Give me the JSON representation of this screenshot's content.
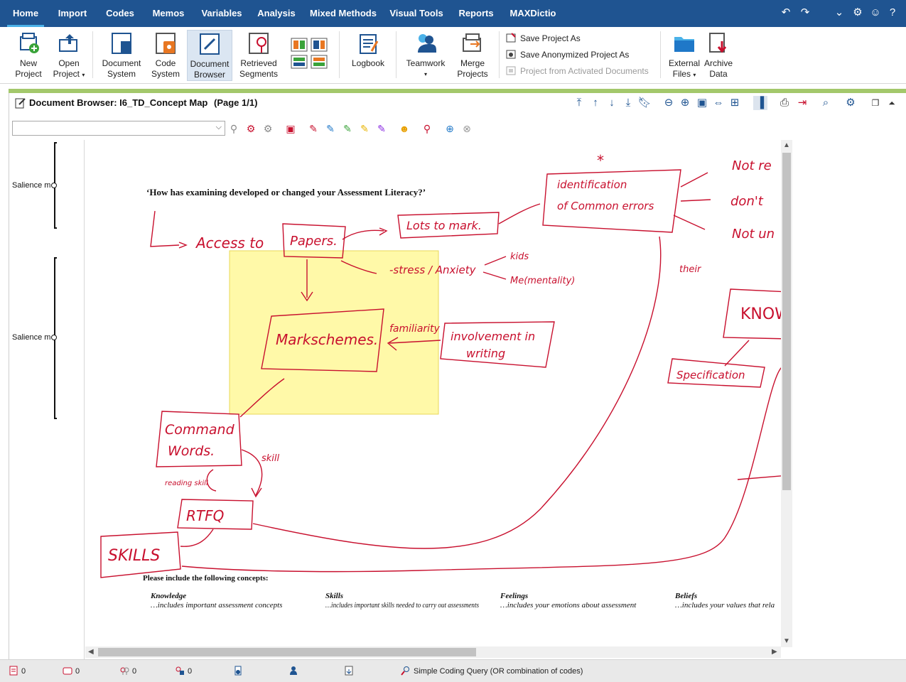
{
  "menu": {
    "tabs": [
      "Home",
      "Import",
      "Codes",
      "Memos",
      "Variables",
      "Analysis",
      "Mixed Methods",
      "Visual Tools",
      "Reports",
      "MAXDictio"
    ],
    "active": "Home"
  },
  "ribbon": {
    "new_project": [
      "New",
      "Project"
    ],
    "open_project": [
      "Open",
      "Project"
    ],
    "document_system": [
      "Document",
      "System"
    ],
    "code_system": [
      "Code",
      "System"
    ],
    "document_browser": [
      "Document",
      "Browser"
    ],
    "retrieved_segments": [
      "Retrieved",
      "Segments"
    ],
    "logbook": "Logbook",
    "teamwork": "Teamwork",
    "merge_projects": [
      "Merge",
      "Projects"
    ],
    "save_project_as": "Save Project As",
    "save_anonymized": "Save Anonymized Project As",
    "project_from_activated": "Project from Activated Documents",
    "external_files": [
      "External",
      "Files"
    ],
    "archive_data": [
      "Archive",
      "Data"
    ]
  },
  "document_browser": {
    "title": "Document Browser: I6_TD_Concept Map",
    "page": "(Page 1/1)",
    "code_selector_value": ""
  },
  "margin_codes": [
    {
      "label": "Salience m"
    },
    {
      "label": "Salience m"
    }
  ],
  "document": {
    "question": "‘How has examining developed or changed your Assessment Literacy?’",
    "include_heading": "Please include the following concepts:",
    "concepts": [
      {
        "name": "Knowledge",
        "desc": "…includes important assessment concepts"
      },
      {
        "name": "Skills",
        "desc": "…includes important skills needed to carry out assessments"
      },
      {
        "name": "Feelings",
        "desc": "…includes your emotions about assessment"
      },
      {
        "name": "Beliefs",
        "desc": "…includes your values that rela"
      }
    ],
    "handwriting": {
      "access": "Access to",
      "papers": "Papers.",
      "lots_to_mark": "Lots to mark.",
      "identification": "identification",
      "of_common_errors": "of Common errors",
      "not1": "Not re",
      "dont": "don't",
      "not2": "Not un",
      "stress": "-stress / Anxiety",
      "kids": "kids",
      "me": "Me(mentality)",
      "markschemes": "Markschemes.",
      "familiarity": "familiarity",
      "involvement": "involvement in",
      "writing": "writing",
      "know": "KNOW",
      "specification": "Specification",
      "their": "their",
      "command": "Command",
      "words": "Words.",
      "skill": "skill",
      "reading_skill": "reading skill",
      "rtfq": "RTFQ",
      "skills": "SKILLS"
    }
  },
  "status": {
    "docs": "0",
    "memos": "0",
    "codes": "0",
    "coded_segments": "0",
    "query": "Simple Coding Query (OR combination of codes)"
  },
  "colors": {
    "menubar": "#1f5491",
    "highlight": "#fff9a8",
    "ink": "#c8102e",
    "accent": "#a3c86b"
  }
}
